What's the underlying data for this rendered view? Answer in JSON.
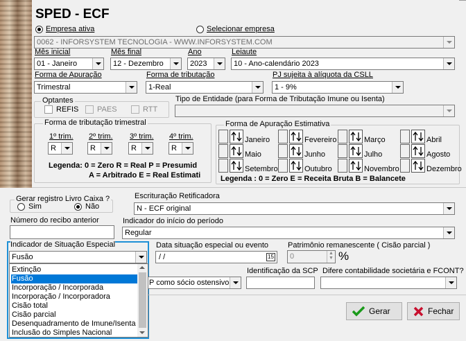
{
  "title": "SPED - ECF",
  "company_mode": {
    "option_active": "Empresa ativa",
    "option_select": "Selecionar empresa"
  },
  "company_value": "0062 - INFORSYSTEM TECNOLOGIA - WWW.INFORSYSTEM.COM",
  "period": {
    "mes_inicial_label": "Mês inicial",
    "mes_inicial": "01 - Janeiro",
    "mes_final_label": "Mês final",
    "mes_final": "12 - Dezembro",
    "ano_label": "Ano",
    "ano": "2023",
    "leiaute_label": "Leiaute",
    "leiaute": "10 - Ano-calendário 2023"
  },
  "apuracao": {
    "forma_label": "Forma de Apuração",
    "forma": "Trimestral",
    "tributacao_label": "Forma de tributação",
    "tributacao": "1-Real",
    "csll_label": "PJ sujeita à alíquota da CSLL",
    "csll": "1 - 9%"
  },
  "optantes": {
    "title": "Optantes",
    "items": [
      "REFIS",
      "PAES",
      "RTT"
    ]
  },
  "tipo_entidade_label": "Tipo de Entidade (para Forma de Tributação Imune ou Isenta)",
  "trimestral": {
    "title": "Forma de tributação trimestral",
    "labels": [
      "1º trim.",
      "2º trim.",
      "3º trim.",
      "4º trim."
    ],
    "values": [
      "R",
      "R",
      "R",
      "R"
    ],
    "legend1": "Legenda:  0 = Zero  R = Real  P = Presumid",
    "legend2": "A = Arbitrado  E = Real Estimati"
  },
  "estimativa": {
    "title": "Forma de Apuração Estimativa",
    "months": [
      "Janeiro",
      "Fevereiro",
      "Março",
      "Abril",
      "Maio",
      "Junho",
      "Julho",
      "Agosto",
      "Setembro",
      "Outubro",
      "Novembro",
      "Dezembro"
    ],
    "legend": "Legenda : 0 = Zero   E = Receita Bruta   B = Balancete"
  },
  "livro_caixa": {
    "title": "Gerar registro Livro Caixa ?",
    "sim": "Sim",
    "nao": "Não"
  },
  "escrituracao": {
    "label": "Escrituração Retificadora",
    "value": "N - ECF original"
  },
  "recibo_label": "Número do recibo anterior",
  "inicio_periodo": {
    "label": "Indicador do início do período",
    "value": "Regular"
  },
  "situacao_especial": {
    "label": "Indicador de Situação Especial",
    "value": "Fusão",
    "options": [
      "Extinção",
      "Fusão",
      "Incorporação / Incorporada",
      "Incorporação / Incorporadora",
      "Cisão total",
      "Cisão parcial",
      "Desenquadramento de Imune/Isenta",
      "Inclusão do Simples Nacional"
    ]
  },
  "data_situacao": {
    "label": "Data situação especial ou evento",
    "value": " / /"
  },
  "patrimonio": {
    "label": "Patrimônio remanescente ( Cisão parcial )",
    "value": "0",
    "unit": "%"
  },
  "scp": {
    "socio_value": "P como sócio ostensivo",
    "id_label": "Identificação da SCP",
    "contab_label": "Difere contabilidade societária e FCONT?"
  },
  "buttons": {
    "gerar": "Gerar",
    "fechar": "Fechar"
  },
  "colors": {
    "accent": "#0078d7",
    "focus_border": "#1e90d6",
    "ok_green": "#1a9a1a",
    "close_red": "#c8102e"
  }
}
